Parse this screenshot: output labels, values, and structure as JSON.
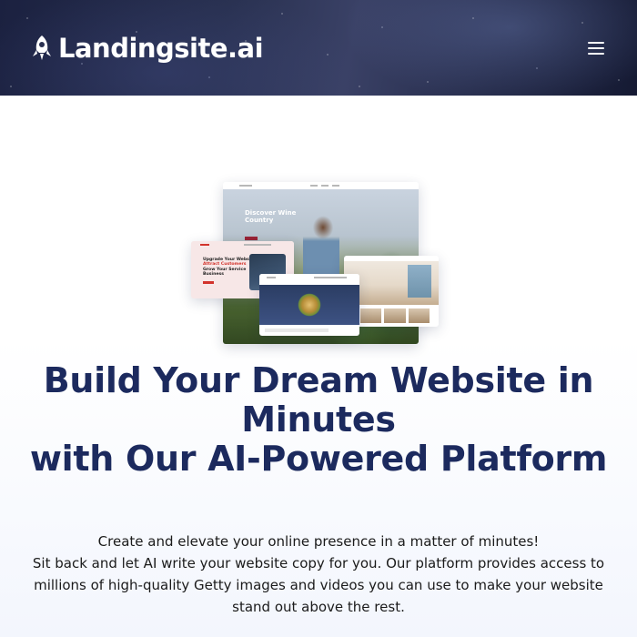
{
  "header": {
    "brand": "Landingsite.ai",
    "logo_icon": "rocket-icon",
    "menu_icon": "hamburger-menu-icon",
    "background": "starry-night-sky"
  },
  "hero": {
    "collage": {
      "main_card_title": "Discover Wine Country",
      "pink_card_title_line1": "Upgrade Your Website",
      "pink_card_title_accent": "Attract Customers",
      "pink_card_title_line3": "Grow Your Service Business"
    },
    "headline_line1": "Build Your Dream Website in Minutes",
    "headline_line2": "with Our AI-Powered Platform",
    "subtext_line1": "Create and elevate your online presence in a matter of minutes!",
    "subtext_line2": "Sit back and let AI write your website copy for you. Our platform provides access to millions of high-quality Getty images and videos you can use to make your website stand out above the rest."
  },
  "colors": {
    "headline": "#1c2a5e",
    "header_bg": "#242a48",
    "accent_red": "#d2332c"
  }
}
